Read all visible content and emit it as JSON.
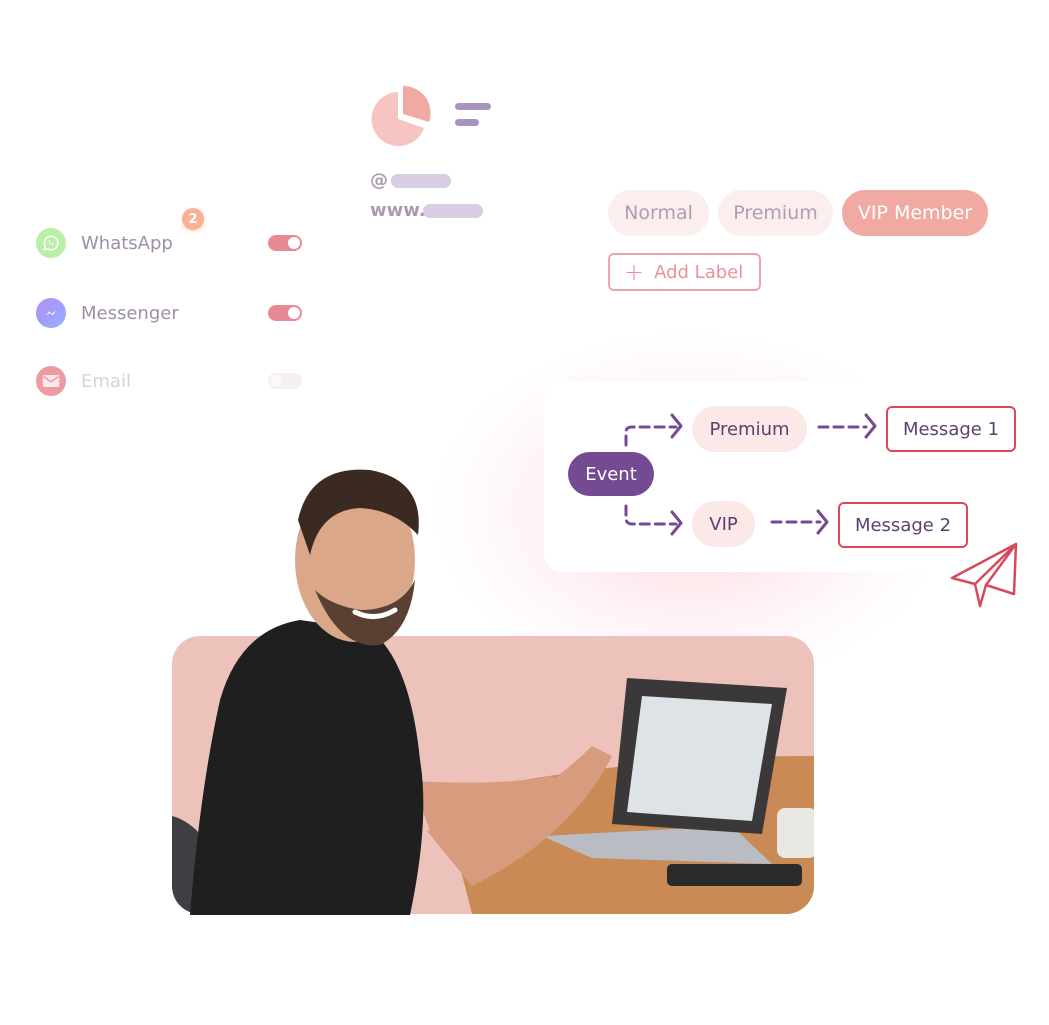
{
  "channels": [
    {
      "name": "WhatsApp",
      "icon": "whatsapp-icon",
      "enabled": true,
      "badge": "2",
      "color": "#b9efa7"
    },
    {
      "name": "Messenger",
      "icon": "messenger-icon",
      "enabled": true,
      "color": "#b99af7"
    },
    {
      "name": "Email",
      "icon": "email-icon",
      "enabled": false,
      "color": "#ee9aa1"
    }
  ],
  "profile": {
    "avatar_icon": "pie-chart-icon",
    "menu_icon": "menu-lines-icon",
    "handle_prefix": "@",
    "website_prefix": "www."
  },
  "labels": {
    "tags": [
      {
        "label": "Normal",
        "selected": false
      },
      {
        "label": "Premium",
        "selected": false
      },
      {
        "label": "VIP Member",
        "selected": true
      }
    ],
    "add_label": "Add Label"
  },
  "flow": {
    "trigger": "Event",
    "branches": [
      {
        "condition": "Premium",
        "message": "Message 1"
      },
      {
        "condition": "VIP",
        "message": "Message 2"
      }
    ],
    "send_icon": "paper-plane-icon"
  },
  "colors": {
    "accent_purple": "#744b93",
    "accent_pink": "#f1aaa2",
    "message_border": "#d84a59",
    "toggle_on": "#e88a93"
  },
  "photo": {
    "description": "Smiling man in black t-shirt with earphones sitting at a wooden desk with a laptop, phone and coffee cup"
  }
}
